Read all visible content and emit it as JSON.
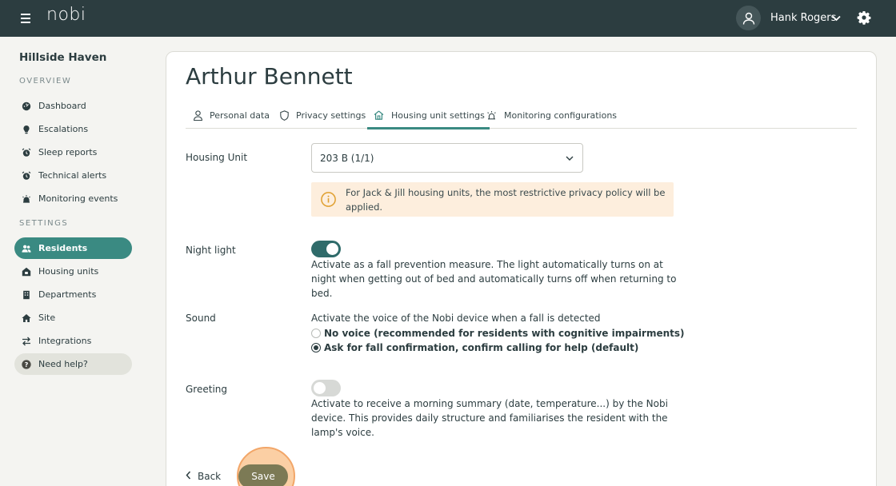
{
  "header": {
    "logo": "nobi",
    "user_name": "Hank Rogers"
  },
  "sidebar": {
    "site_name": "Hillside Haven",
    "overview_label": "OVERVIEW",
    "settings_label": "SETTINGS",
    "overview_items": [
      {
        "label": "Dashboard",
        "icon": "dashboard-icon"
      },
      {
        "label": "Escalations",
        "icon": "escalation-icon"
      },
      {
        "label": "Sleep reports",
        "icon": "alarm-icon"
      },
      {
        "label": "Technical alerts",
        "icon": "alarm-icon"
      },
      {
        "label": "Monitoring events",
        "icon": "monitoring-icon"
      }
    ],
    "settings_items": [
      {
        "label": "Residents",
        "icon": "users-icon",
        "active": true
      },
      {
        "label": "Housing units",
        "icon": "house-lock-icon"
      },
      {
        "label": "Departments",
        "icon": "building-icon"
      },
      {
        "label": "Site",
        "icon": "home-icon"
      },
      {
        "label": "Integrations",
        "icon": "swap-icon"
      }
    ],
    "help_label": "Need help?"
  },
  "resident": {
    "name": "Arthur Bennett"
  },
  "tabs": [
    {
      "label": "Personal data",
      "icon": "person-icon"
    },
    {
      "label": "Privacy settings",
      "icon": "shield-icon"
    },
    {
      "label": "Housing unit settings",
      "icon": "house-icon",
      "active": true
    },
    {
      "label": "Monitoring configurations",
      "icon": "monitoring-icon"
    }
  ],
  "form": {
    "housing_unit_label": "Housing Unit",
    "housing_unit_value": "203 B (1/1)",
    "notice": "For Jack & Jill housing units, the most restrictive privacy policy will be applied.",
    "night_light_label": "Night light",
    "night_light_on": true,
    "night_light_desc": "Activate as a fall prevention measure. The light automatically turns on at night when getting out of bed and automatically turns off when returning to bed.",
    "sound_label": "Sound",
    "sound_desc": "Activate the voice of the Nobi device when a fall is detected",
    "sound_options": [
      {
        "label": "No voice (recommended for residents with cognitive impairments)",
        "checked": false
      },
      {
        "label": "Ask for fall confirmation, confirm calling for help (default)",
        "checked": true
      }
    ],
    "greeting_label": "Greeting",
    "greeting_on": false,
    "greeting_desc": "Activate to receive a morning summary (date, temperature...) by the Nobi device. This provides daily structure and familiarises the resident with the lamp's voice."
  },
  "actions": {
    "back_label": "Back",
    "save_label": "Save"
  },
  "colors": {
    "topbar": "#2c3d40",
    "accent": "#3a8a82",
    "toggle_on": "#2f6b6a",
    "notice_bg": "#fdeedd",
    "save_bg": "#7c7a55"
  }
}
